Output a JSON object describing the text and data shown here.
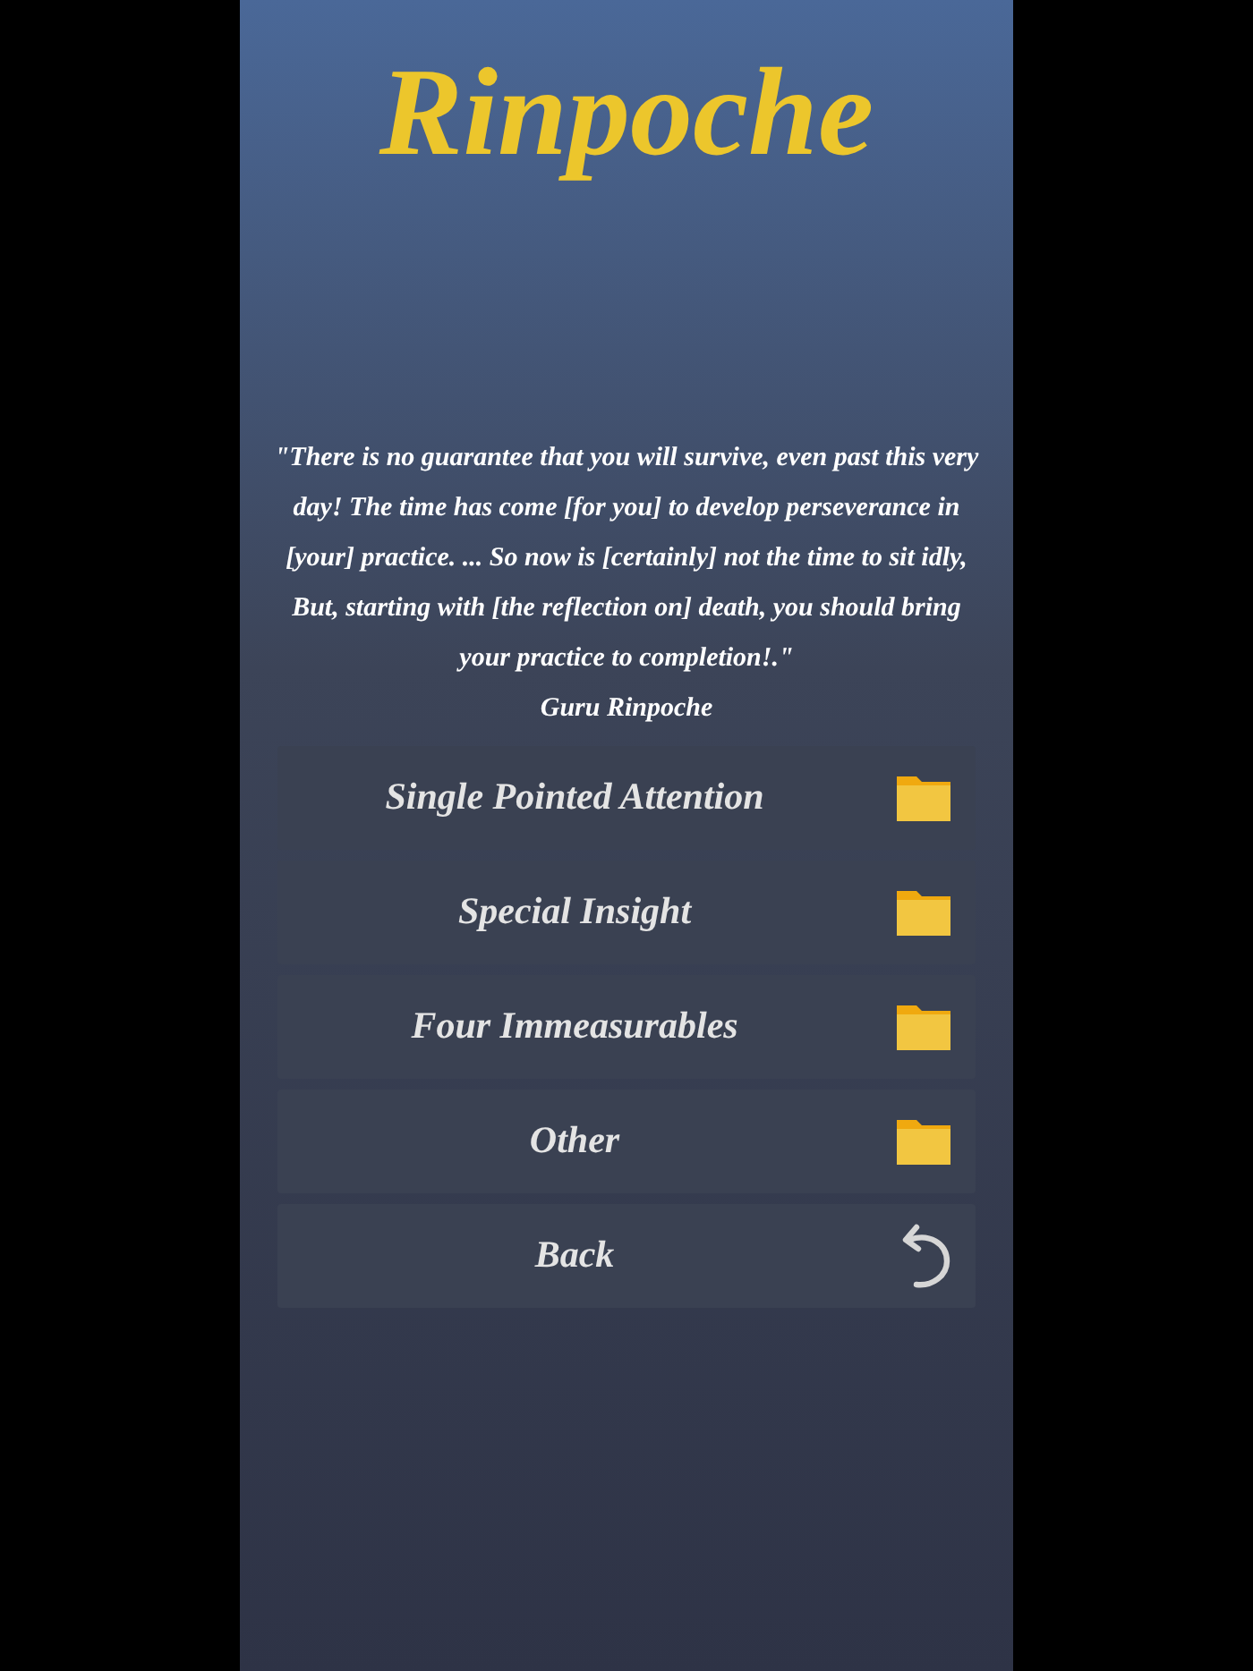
{
  "app_title": "Rinpoche",
  "quote": {
    "text": "\"There is no guarantee that you will survive, even past this very day! The time has come [for you] to develop perseverance in [your] practice. ... So now is [certainly] not the time to sit idly, But, starting with [the reflection on] death, you should bring your practice to completion!.\"",
    "author": "Guru Rinpoche"
  },
  "menu": [
    {
      "label": "Single Pointed Attention",
      "kind": "folder"
    },
    {
      "label": "Special Insight",
      "kind": "folder"
    },
    {
      "label": "Four Immeasurables",
      "kind": "folder"
    },
    {
      "label": "Other",
      "kind": "folder"
    },
    {
      "label": "Back",
      "kind": "back"
    }
  ]
}
